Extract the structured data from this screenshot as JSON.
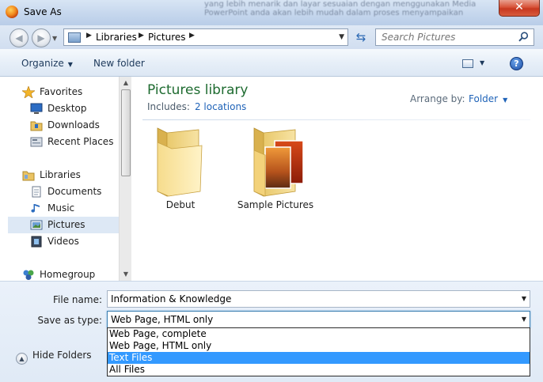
{
  "window": {
    "title": "Save As",
    "close_label": "✕",
    "background_text": "yang lebih menarik dan layar sesuaian dengan menggunakan Media PowerPoint anda akan lebih mudah dalam proses menyampaikan"
  },
  "address": {
    "crumbs": [
      "Libraries",
      "Pictures"
    ],
    "search_placeholder": "Search Pictures"
  },
  "toolbar": {
    "organize_label": "Organize",
    "new_folder_label": "New folder",
    "help_label": "?"
  },
  "nav": {
    "items": [
      {
        "label": "Favorites",
        "icon": "star-icon"
      },
      {
        "label": "Desktop",
        "icon": "desktop-icon"
      },
      {
        "label": "Downloads",
        "icon": "downloads-folder-icon"
      },
      {
        "label": "Recent Places",
        "icon": "recent-places-icon"
      },
      {
        "label": "Libraries",
        "icon": "libraries-icon"
      },
      {
        "label": "Documents",
        "icon": "documents-icon"
      },
      {
        "label": "Music",
        "icon": "music-icon"
      },
      {
        "label": "Pictures",
        "icon": "pictures-icon",
        "selected": true
      },
      {
        "label": "Videos",
        "icon": "videos-icon"
      },
      {
        "label": "Homegroup",
        "icon": "homegroup-icon"
      }
    ]
  },
  "library": {
    "title": "Pictures library",
    "includes_label": "Includes:",
    "includes_link": "2 locations",
    "arrange_label": "Arrange by:",
    "arrange_value": "Folder"
  },
  "folders": [
    {
      "label": "Debut",
      "icon": "empty-folder-icon"
    },
    {
      "label": "Sample Pictures",
      "icon": "photo-folder-icon"
    }
  ],
  "form": {
    "file_name_label": "File name:",
    "file_name_value": "Information & Knowledge",
    "save_type_label": "Save as type:",
    "save_type_value": "Web Page, HTML only",
    "hide_folders_label": "Hide Folders",
    "type_options": [
      "Web Page, complete",
      "Web Page, HTML only",
      "Text Files",
      "All Files"
    ],
    "highlighted_option": "Text Files"
  },
  "colors": {
    "title_accent": "#1e6b30",
    "link": "#1f63b8",
    "highlight": "#3399ff"
  }
}
